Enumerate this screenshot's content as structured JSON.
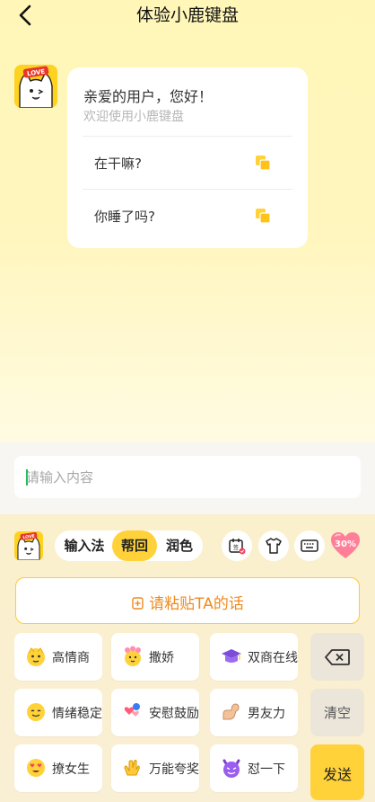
{
  "header": {
    "title": "体验小鹿键盘"
  },
  "chat": {
    "greeting": "亲爱的用户，您好！",
    "subtitle": "欢迎使用小鹿键盘",
    "suggestions": [
      {
        "text": "在干嘛?"
      },
      {
        "text": "你睡了吗?"
      }
    ],
    "avatar_badge": "LOVE"
  },
  "input": {
    "placeholder": "请输入内容",
    "value": ""
  },
  "keyboard": {
    "avatar_badge": "LOVE",
    "modes": [
      "输入法",
      "帮回",
      "润色"
    ],
    "active_mode": "帮回",
    "tools": [
      "calendar-check-icon",
      "tshirt-icon",
      "keyboard-icon",
      "heart-progress-icon"
    ],
    "heart_progress": "30%",
    "paste_label": "请粘贴TA的话",
    "keys": [
      {
        "label": "高情商"
      },
      {
        "label": "撒娇"
      },
      {
        "label": "双商在线"
      },
      {
        "label": "情绪稳定"
      },
      {
        "label": "安慰鼓励"
      },
      {
        "label": "男友力"
      },
      {
        "label": "撩女生"
      },
      {
        "label": "万能夸奖"
      },
      {
        "label": "怼一下"
      }
    ],
    "clear_label": "清空",
    "send_label": "发送"
  },
  "colors": {
    "accent": "#ffd23a",
    "paste_text": "#f08a1e",
    "background": "#fff6b8"
  }
}
